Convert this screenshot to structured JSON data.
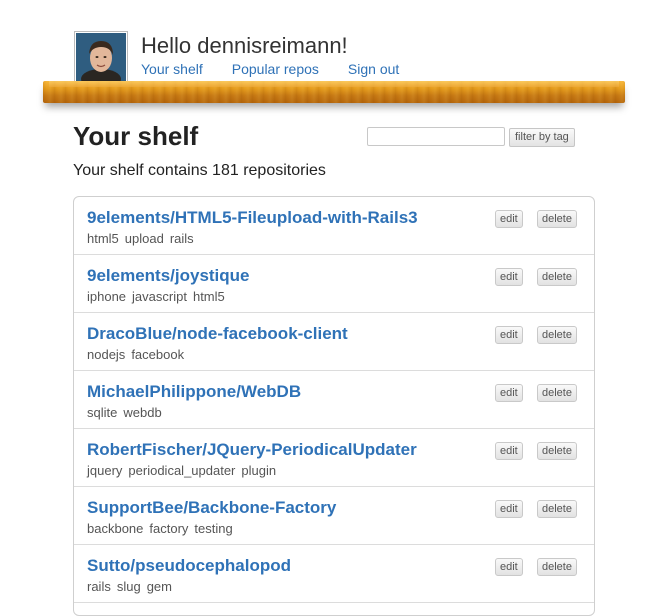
{
  "header": {
    "greeting": "Hello dennisreimann!",
    "nav": [
      "Your shelf",
      "Popular repos",
      "Sign out"
    ]
  },
  "page": {
    "title": "Your shelf",
    "filter_placeholder": "",
    "filter_button": "filter by tag",
    "count_text": "Your shelf contains 181 repositories"
  },
  "repos": [
    {
      "name": "9elements/HTML5-Fileupload-with-Rails3",
      "tags": [
        "html5",
        "upload",
        "rails"
      ]
    },
    {
      "name": "9elements/joystique",
      "tags": [
        "iphone",
        "javascript",
        "html5"
      ]
    },
    {
      "name": "DracoBlue/node-facebook-client",
      "tags": [
        "nodejs",
        "facebook"
      ]
    },
    {
      "name": "MichaelPhilippone/WebDB",
      "tags": [
        "sqlite",
        "webdb"
      ]
    },
    {
      "name": "RobertFischer/JQuery-PeriodicalUpdater",
      "tags": [
        "jquery",
        "periodical_updater",
        "plugin"
      ]
    },
    {
      "name": "SupportBee/Backbone-Factory",
      "tags": [
        "backbone",
        "factory",
        "testing"
      ]
    },
    {
      "name": "Sutto/pseudocephalopod",
      "tags": [
        "rails",
        "slug",
        "gem"
      ]
    }
  ],
  "row_actions": {
    "edit": "edit",
    "delete": "delete"
  },
  "colors": {
    "link": "#2f72b7",
    "shelf_wood": "#e49a1b"
  }
}
